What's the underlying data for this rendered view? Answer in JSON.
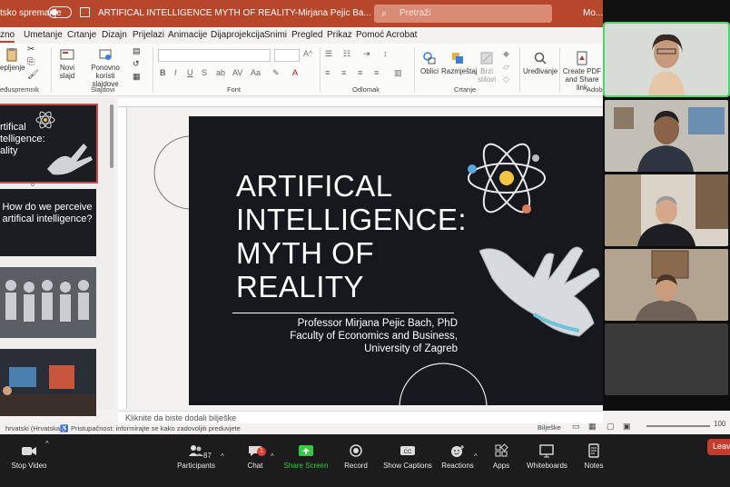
{
  "titlebar": {
    "autosave_label": "tsko spremanje",
    "doc_title": "ARTIFICAL INTELLIGENCE MYTH OF REALITY-Mirjana Pejic Ba...  •  Spremljeno na ovaj PC",
    "search_placeholder": "Pretraži",
    "user_name": "Mo..."
  },
  "menu": {
    "tabs": [
      "zno",
      "Umetanje",
      "Crtanje",
      "Dizajn",
      "Prijelazi",
      "Animacije",
      "Dijaprojekcija",
      "Snimi",
      "Pregled",
      "Prikaz",
      "Pomoć",
      "Acrobat"
    ]
  },
  "ribbon": {
    "paste_label": "epljenje",
    "clipboard_label": "eđuspremnik",
    "new_slide_label": "Novi slajd",
    "reuse_label": "Ponovno koristi slajdove",
    "slides_group_label": "Slajdovi",
    "font_group_label": "Font",
    "paragraph_group_label": "Odlomak",
    "shapes_label": "Oblici",
    "arrange_label": "Razmještaj",
    "quick_styles_label": "Brzi stilovi",
    "drawing_group_label": "Crtanje",
    "editing_label": "Uređivanje",
    "create_pdf_label": "Create PDF and Share link",
    "adobe_group_label": "Adobe"
  },
  "thumbnails": [
    {
      "text": "rtifical telligence: ality",
      "number": "6"
    },
    {
      "text": "How do we perceive artifical intelligence?",
      "number": ""
    },
    {
      "text": "",
      "number": ""
    },
    {
      "text": "",
      "number": ""
    }
  ],
  "slide": {
    "title": "ARTIFICAL INTELLIGENCE: MYTH OF REALITY",
    "author_line1": "Professor Mirjana Pejic Bach, PhD",
    "author_line2": "Faculty of Economics and Business,",
    "author_line3": "University of Zagreb"
  },
  "notes_placeholder": "Kliknite da biste dodali bilješke",
  "status": {
    "language": "hrvatski (Hrvatska)",
    "accessibility": "Pristupačnost: informirajte se kako zadovoljiti preduvjete",
    "notes_button": "Bilješke",
    "zoom": "100"
  },
  "zoom_controls": {
    "stop_video": "Stop Video",
    "participants": "Participants",
    "participants_count": "87",
    "chat": "Chat",
    "chat_badge": "1",
    "share_screen": "Share Screen",
    "record": "Record",
    "show_captions": "Show Captions",
    "reactions": "Reactions",
    "apps": "Apps",
    "whiteboards": "Whiteboards",
    "notes": "Notes",
    "leave": "Leave"
  },
  "colors": {
    "ppt_accent": "#b7472a",
    "slide_bg": "#16181d",
    "share_green": "#2ecc40",
    "leave_red": "#c73b2e"
  }
}
